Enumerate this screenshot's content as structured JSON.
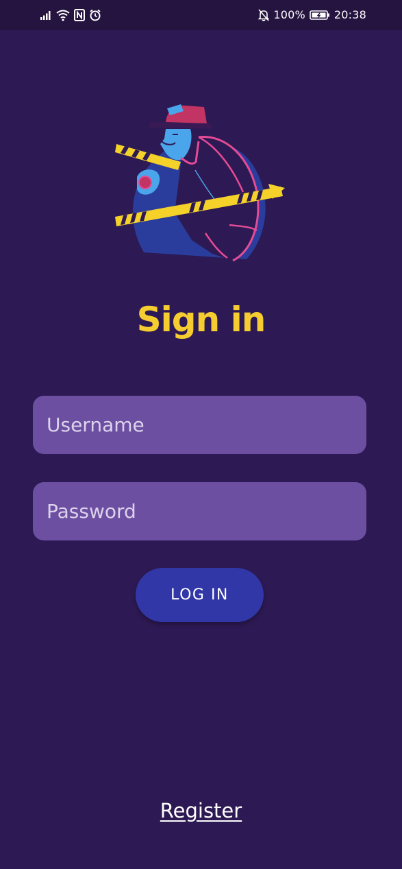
{
  "status_bar": {
    "battery": "100%",
    "time": "20:38",
    "left_icons": [
      "signal-icon",
      "wifi-icon",
      "nfc-icon",
      "alarm-icon"
    ],
    "right_icons": [
      "bell-muted-icon",
      "battery-icon"
    ]
  },
  "illustration": {
    "name": "detective-illustration",
    "colors": {
      "circle": "#2a3d9c",
      "coat_outline": "#e54b96",
      "hat": "#c23463",
      "face": "#4ba5ea",
      "tape": "#f5d22a"
    }
  },
  "title": "Sign in",
  "form": {
    "username_placeholder": "Username",
    "password_placeholder": "Password",
    "login_label": "LOG IN"
  },
  "register_label": "Register",
  "colors": {
    "background": "#2d1953",
    "status_bar": "#25143f",
    "title": "#f5cd30",
    "field": "#6d4fa2",
    "button": "#3137a6"
  }
}
